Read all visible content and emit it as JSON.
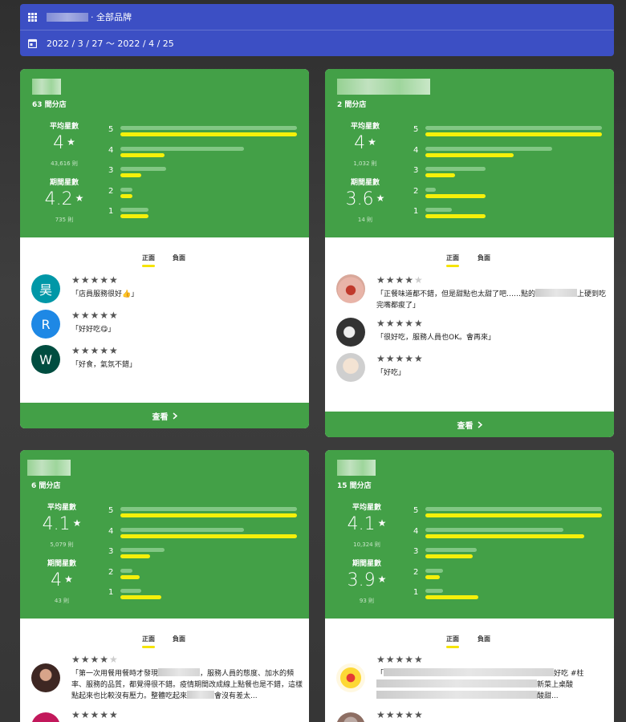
{
  "header": {
    "brand_suffix": "· 全部品牌",
    "date_range": "2022 / 3 / 27 ～ 2022 / 4 / 25",
    "menu_icon": "grid-icon",
    "date_icon": "calendar-icon"
  },
  "labels": {
    "avg_rating": "平均星數",
    "period_rating": "期間星數",
    "tab_positive": "正面",
    "tab_negative": "負面",
    "view": "查看"
  },
  "colors": {
    "header": "#3c4fc4",
    "card": "#43a047",
    "bar_fill": "#f5f00a",
    "bar_track": "#82c784"
  },
  "cards": [
    {
      "branches": "63 間分店",
      "avg": "4",
      "avg_count": "43,616 則",
      "period": "4.2",
      "period_count": "735 則",
      "bars": [
        {
          "label": "5",
          "track": 1.0,
          "fill": 1.0
        },
        {
          "label": "4",
          "track": 0.7,
          "fill": 0.25
        },
        {
          "label": "3",
          "track": 0.26,
          "fill": 0.12
        },
        {
          "label": "2",
          "track": 0.07,
          "fill": 0.07
        },
        {
          "label": "1",
          "track": 0.16,
          "fill": 0.16
        }
      ],
      "reviews": [
        {
          "avatar_letter": "昊",
          "avatar_color": "#0097a7",
          "stars": 5,
          "text": "「店員服務很好👍」"
        },
        {
          "avatar_letter": "R",
          "avatar_color": "#1e88e5",
          "stars": 5,
          "text": "「好好吃😋」"
        },
        {
          "avatar_letter": "W",
          "avatar_color": "#004d40",
          "stars": 5,
          "text": "「好食，氣氛不錯」"
        }
      ]
    },
    {
      "branches": "2 間分店",
      "avg": "4",
      "avg_count": "1,032 則",
      "period": "3.6",
      "period_count": "14 則",
      "bars": [
        {
          "label": "5",
          "track": 1.0,
          "fill": 1.0
        },
        {
          "label": "4",
          "track": 0.72,
          "fill": 0.5
        },
        {
          "label": "3",
          "track": 0.34,
          "fill": 0.17
        },
        {
          "label": "2",
          "track": 0.06,
          "fill": 0.34
        },
        {
          "label": "1",
          "track": 0.15,
          "fill": 0.34
        }
      ],
      "reviews": [
        {
          "avatar_letter": "",
          "avatar_color": "#b55a4a",
          "stars": 4,
          "text_a": "「正餐味道都不錯，但是甜點也太甜了吧……點的",
          "text_b": "上硬到吃完嘴都痠了」"
        },
        {
          "avatar_letter": "",
          "avatar_color": "#333333",
          "stars": 5,
          "text": "「很好吃，服務人員也OK。會再來」"
        },
        {
          "avatar_letter": "",
          "avatar_color": "#bbbbbb",
          "stars": 5,
          "text": "「好吃」"
        }
      ]
    },
    {
      "branches": "6 間分店",
      "avg": "4.1",
      "avg_count": "5,079 則",
      "period": "4",
      "period_count": "43 則",
      "bars": [
        {
          "label": "5",
          "track": 1.0,
          "fill": 1.0
        },
        {
          "label": "4",
          "track": 0.7,
          "fill": 1.0
        },
        {
          "label": "3",
          "track": 0.25,
          "fill": 0.17
        },
        {
          "label": "2",
          "track": 0.07,
          "fill": 0.11
        },
        {
          "label": "1",
          "track": 0.12,
          "fill": 0.23
        }
      ],
      "reviews": [
        {
          "avatar_letter": "",
          "avatar_color": "#4e342e",
          "stars": 4,
          "text_a": "「第一次用餐用餐時才發現",
          "text_b": "，服務人員的態度、加水的頻率、服務的品質，都覺得很不錯。疫情期間改成線上點餐也是不錯，這樣點起來也比較沒有壓力。整體吃起來",
          "text_c": "會沒有差太..."
        },
        {
          "avatar_letter": "",
          "avatar_color": "#c2185b",
          "stars": 5,
          "text": ""
        }
      ]
    },
    {
      "branches": "15 間分店",
      "avg": "4.1",
      "avg_count": "10,324 則",
      "period": "3.9",
      "period_count": "93 則",
      "bars": [
        {
          "label": "5",
          "track": 1.0,
          "fill": 1.0
        },
        {
          "label": "4",
          "track": 0.78,
          "fill": 0.9
        },
        {
          "label": "3",
          "track": 0.29,
          "fill": 0.27
        },
        {
          "label": "2",
          "track": 0.1,
          "fill": 0.08
        },
        {
          "label": "1",
          "track": 0.1,
          "fill": 0.3
        }
      ],
      "reviews": [
        {
          "avatar_letter": "",
          "avatar_color": "#f9c74f",
          "stars": 5,
          "text_a": "「",
          "text_b": "好吃 #柱",
          "text_c": "新菜上桌酸",
          "text_d": "酸甜..."
        },
        {
          "avatar_letter": "",
          "avatar_color": "#8d6e63",
          "stars": 5,
          "text": ""
        }
      ]
    }
  ]
}
